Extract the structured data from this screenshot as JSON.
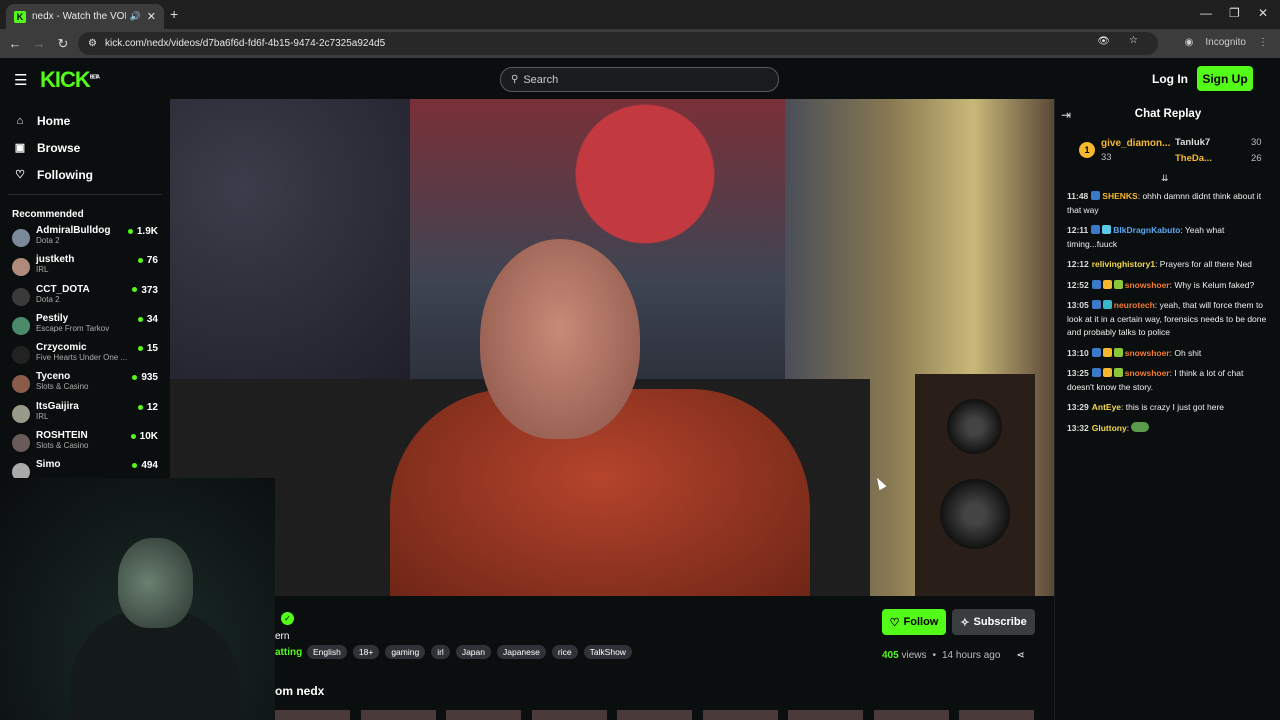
{
  "browser": {
    "tab_title": "nedx - Watch the VOD on",
    "url": "kick.com/nedx/videos/d7ba6f6d-fd6f-4b15-9474-2c7325a924d5",
    "incognito_label": "Incognito"
  },
  "header": {
    "logo": "KICK",
    "logo_badge": "BETA",
    "search_placeholder": "Search",
    "login_label": "Log In",
    "signup_label": "Sign Up"
  },
  "sidebar": {
    "nav": [
      {
        "label": "Home",
        "icon": "home-icon"
      },
      {
        "label": "Browse",
        "icon": "browse-icon"
      },
      {
        "label": "Following",
        "icon": "heart-icon"
      }
    ],
    "recommended_title": "Recommended",
    "channels": [
      {
        "name": "AdmiralBulldog",
        "category": "Dota 2",
        "viewers": "1.9K",
        "color": "#7a8a9a"
      },
      {
        "name": "justketh",
        "category": "IRL",
        "viewers": "76",
        "color": "#b08a7a"
      },
      {
        "name": "CCT_DOTA",
        "category": "Dota 2",
        "viewers": "373",
        "color": "#3a3a3a"
      },
      {
        "name": "Pestily",
        "category": "Escape From Tarkov",
        "viewers": "34",
        "color": "#4a8a6a"
      },
      {
        "name": "Crzycomic",
        "category": "Five Hearts Under One ...",
        "viewers": "15",
        "color": "#222222"
      },
      {
        "name": "Tyceno",
        "category": "Slots & Casino",
        "viewers": "935",
        "color": "#8a5a4a"
      },
      {
        "name": "ItsGaijira",
        "category": "IRL",
        "viewers": "12",
        "color": "#9a9a8a"
      },
      {
        "name": "ROSHTEIN",
        "category": "Slots & Casino",
        "viewers": "10K",
        "color": "#6a5a5a"
      },
      {
        "name": "Simo",
        "category": "",
        "viewers": "494",
        "color": "#aaaaaa"
      }
    ]
  },
  "stream_info": {
    "frag1": "ern",
    "frag2": "atting",
    "tags": [
      "English",
      "18+",
      "gaming",
      "irl",
      "Japan",
      "Japanese",
      "rice",
      "TalkShow"
    ],
    "follow_label": "Follow",
    "subscribe_label": "Subscribe",
    "views": "405",
    "views_label": "views",
    "dot": "•",
    "time_ago": "14 hours ago",
    "from_label": "om nedx"
  },
  "chat": {
    "title": "Chat Replay",
    "pinned": {
      "rank": "1",
      "top_user": "give_diamon...",
      "top_count": "33",
      "user2": "Tanluk7",
      "count2": "30",
      "user3": "TheDa...",
      "count3": "26"
    },
    "messages": [
      {
        "time": "11:48",
        "user": "SHENKS",
        "color": "#f5b82e",
        "text": ": ohhh damnn didnt think about it that way",
        "badges": [
          "#3a7ac8"
        ]
      },
      {
        "time": "12:11",
        "user": "BlkDragnKabuto",
        "color": "#5aa8f5",
        "text": ": Yeah what timing...fuuck",
        "badges": [
          "#3a7ac8",
          "#5ac8e8"
        ]
      },
      {
        "time": "12:12",
        "user": "relivinghistory1",
        "color": "#f5d84a",
        "text": ": Prayers for all there Ned",
        "badges": []
      },
      {
        "time": "12:52",
        "user": "snowshoer",
        "color": "#f57a2e",
        "text": ": Why is Kelum faked?",
        "badges": [
          "#3a7ac8",
          "#f5b82e",
          "#8ac83a"
        ]
      },
      {
        "time": "13:05",
        "user": "neurotech",
        "color": "#f57a2e",
        "text": ": yeah, that will force them to look at it in a certain way, forensics needs to be done and probably talks to police",
        "badges": [
          "#3a7ac8",
          "#3ab8c8"
        ]
      },
      {
        "time": "13:10",
        "user": "snowshoer",
        "color": "#f57a2e",
        "text": ": Oh shit",
        "badges": [
          "#3a7ac8",
          "#f5b82e",
          "#8ac83a"
        ]
      },
      {
        "time": "13:25",
        "user": "snowshoer",
        "color": "#f57a2e",
        "text": ": I think a lot of chat doesn't know the story.",
        "badges": [
          "#3a7ac8",
          "#f5b82e",
          "#8ac83a"
        ]
      },
      {
        "time": "13:29",
        "user": "AntEye",
        "color": "#f5d84a",
        "text": ": this is crazy I just got here",
        "badges": []
      },
      {
        "time": "13:32",
        "user": "Gluttony",
        "color": "#f5d84a",
        "text": ":",
        "badges": [],
        "emote": true
      }
    ]
  }
}
